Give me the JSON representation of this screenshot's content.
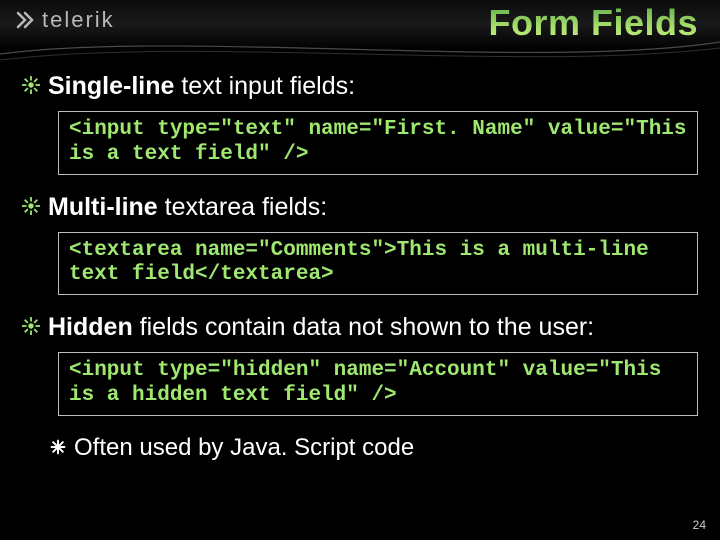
{
  "header": {
    "brand": "telerik",
    "title": "Form Fields"
  },
  "bullets": [
    {
      "lead": "Single-line",
      "rest": " text input fields:",
      "code": "<input type=\"text\" name=\"First. Name\" value=\"This is a text field\" />"
    },
    {
      "lead": "Multi-line",
      "rest": " textarea fields:",
      "code": "<textarea name=\"Comments\">This is a multi-line text field</textarea>"
    },
    {
      "lead": "Hidden",
      "rest": " fields contain data not shown to the user:",
      "code": "<input type=\"hidden\" name=\"Account\" value=\"This is a hidden text field\" />"
    }
  ],
  "sub": {
    "text": "Often used by Java. Script code"
  },
  "page_number": "24"
}
